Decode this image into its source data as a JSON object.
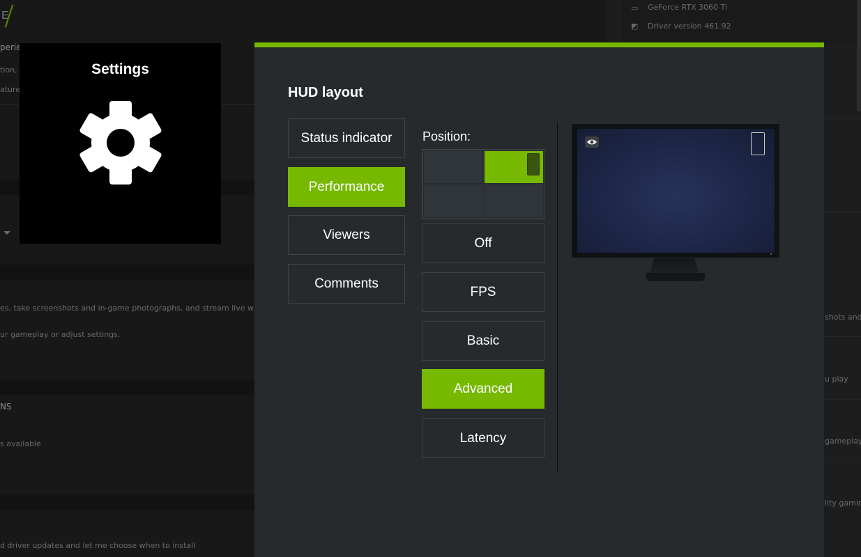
{
  "background": {
    "logo_letter": "E",
    "texts": [
      "perien",
      "tion, AI",
      "atures",
      "es, take screenshots and in-game photographs, and stream live with friends.",
      "ur gameplay or adjust settings.",
      "NS",
      "s available",
      "d driver updates and let me choose when to install"
    ],
    "right_texts": [
      "GeForce RTX 3060 Ti",
      "Driver version 461.92",
      "shots and l",
      "u play",
      "gameplay",
      "lity gaming"
    ]
  },
  "settings_tile": {
    "title": "Settings",
    "icon": "gear-icon"
  },
  "hud": {
    "title": "HUD layout",
    "categories": [
      {
        "label": "Status indicator",
        "active": false
      },
      {
        "label": "Performance",
        "active": true
      },
      {
        "label": "Viewers",
        "active": false
      },
      {
        "label": "Comments",
        "active": false
      }
    ],
    "position_label": "Position:",
    "position_selected": "top-right",
    "modes": [
      {
        "label": "Off",
        "active": false
      },
      {
        "label": "FPS",
        "active": false
      },
      {
        "label": "Basic",
        "active": false
      },
      {
        "label": "Advanced",
        "active": true
      },
      {
        "label": "Latency",
        "active": false
      }
    ]
  },
  "colors": {
    "accent": "#76b900",
    "panel": "#262a2d",
    "tile": "#000000"
  }
}
